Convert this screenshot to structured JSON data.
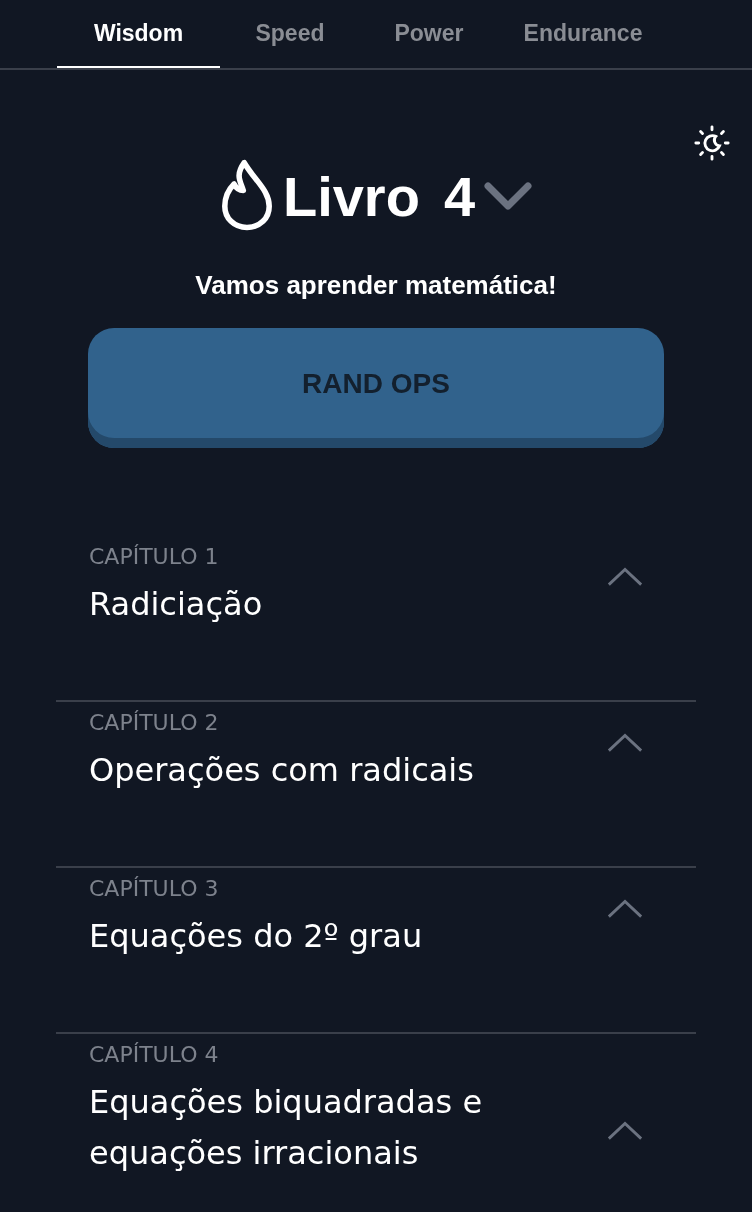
{
  "tabs": [
    {
      "label": "Wisdom",
      "selected": true
    },
    {
      "label": "Speed",
      "selected": false
    },
    {
      "label": "Power",
      "selected": false
    },
    {
      "label": "Endurance",
      "selected": false
    }
  ],
  "book": {
    "title": "Livro",
    "number": "4"
  },
  "subtitle": "Vamos aprender matemática!",
  "button": "RAND OPS",
  "chapters": [
    {
      "label": "CAPÍTULO 1",
      "title": "Radiciação"
    },
    {
      "label": "CAPÍTULO 2",
      "title": "Operações com radicais"
    },
    {
      "label": "CAPÍTULO 3",
      "title": "Equações do 2º grau"
    },
    {
      "label": "CAPÍTULO 4",
      "title": "Equações biquadradas e equações irracionais"
    }
  ]
}
